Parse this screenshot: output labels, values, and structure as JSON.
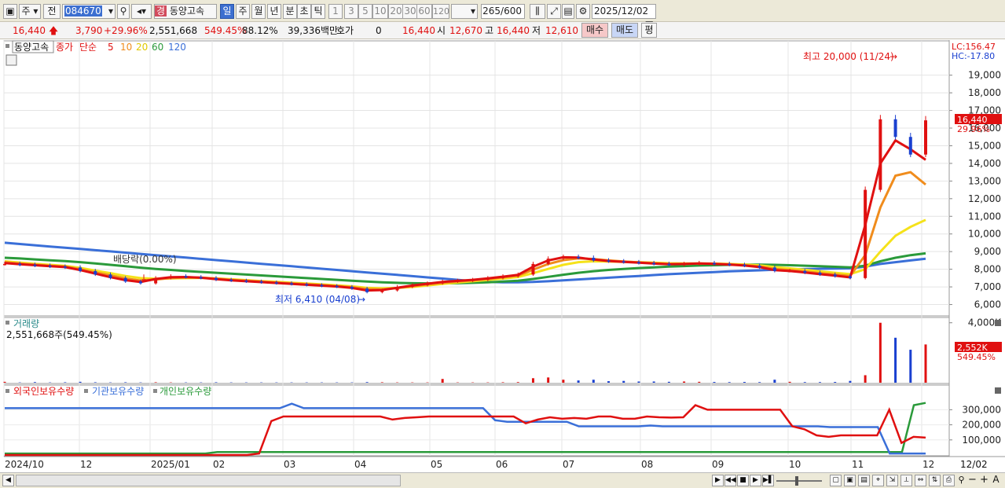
{
  "toolbar": {
    "period": "주",
    "prev": "전",
    "code": "084670",
    "stock_name": "동양고속",
    "name_badge": "경",
    "tabs": [
      "일",
      "주",
      "월",
      "년",
      "분",
      "초",
      "틱"
    ],
    "active_tab": "일",
    "intervals": [
      "1",
      "3",
      "5",
      "10",
      "20",
      "30",
      "60",
      "120"
    ],
    "count": "265",
    "count_total": "/600",
    "date": "2025/12/02"
  },
  "quote": {
    "price": "16,440",
    "change": "3,790",
    "change_pct": "+29.96%",
    "volume": "2,551,668",
    "volume_pct": "549.45%",
    "ratio": "88.12%",
    "amount": "39,336백만",
    "hoga_label": "호가",
    "hoga": "0",
    "ask": "16,440",
    "open_label": "시",
    "open": "12,670",
    "high_label": "고",
    "high": "16,440",
    "low_label": "저",
    "low": "12,610",
    "buy": "매수",
    "sell": "매도",
    "eval": "평"
  },
  "legend": {
    "name": "동양고속",
    "close_label": "종가",
    "simple": "단순",
    "ma": [
      "5",
      "10",
      "20",
      "60",
      "120"
    ]
  },
  "colors": {
    "up": "#e01010",
    "down": "#1a40d0",
    "ma5": "#e01010",
    "ma10": "#f08c1c",
    "ma20": "#f5e21a",
    "ma60": "#2a9a3a",
    "ma120": "#3a6fd8",
    "foreign": "#e01010",
    "institution": "#3a6fd8",
    "individual": "#2a9a3a"
  },
  "chart_data": [
    {
      "type": "candlestick",
      "title": "동양고속",
      "y_ticks": [
        "6,000",
        "7,000",
        "8,000",
        "9,000",
        "10,000",
        "11,000",
        "12,000",
        "13,000",
        "14,000",
        "15,000",
        "16,000",
        "17,000",
        "18,000",
        "19,000"
      ],
      "ylim": [
        5400,
        20900
      ],
      "x_ticks": [
        "2024/10",
        "12",
        "2025/01",
        "02",
        "03",
        "04",
        "05",
        "06",
        "07",
        "08",
        "09",
        "10",
        "11",
        "12"
      ],
      "last_price": "16,440",
      "last_pct": "29.96%",
      "lc": "LC:156.47",
      "hc": "HC:-17.80",
      "annotations": {
        "high": "최고 20,000 (11/24)",
        "low": "최저 6,410 (04/08)",
        "dividend": "배당락(0.00%)"
      },
      "series": [
        {
          "name": "종가",
          "values": [
            8300,
            8250,
            8200,
            8150,
            8100,
            7900,
            7700,
            7500,
            7300,
            7200,
            7500,
            7600,
            7550,
            7500,
            7400,
            7350,
            7300,
            7250,
            7200,
            7150,
            7100,
            7050,
            7000,
            6900,
            6700,
            6800,
            7000,
            7100,
            7200,
            7300,
            7350,
            7400,
            7500,
            7600,
            7700,
            8300,
            8600,
            8700,
            8650,
            8500,
            8450,
            8400,
            8350,
            8300,
            8250,
            8300,
            8350,
            8300,
            8250,
            8200,
            8100,
            7900,
            7900,
            7800,
            7700,
            7600,
            7500,
            12500,
            16500,
            15500,
            14500,
            16440
          ]
        },
        {
          "name": "5",
          "values": [
            8350,
            8280,
            8230,
            8170,
            8120,
            7950,
            7750,
            7550,
            7380,
            7280,
            7450,
            7550,
            7560,
            7520,
            7440,
            7370,
            7320,
            7270,
            7220,
            7170,
            7120,
            7070,
            7020,
            6940,
            6800,
            6820,
            6950,
            7080,
            7180,
            7280,
            7340,
            7400,
            7480,
            7580,
            7680,
            8150,
            8500,
            8680,
            8660,
            8550,
            8470,
            8420,
            8370,
            8320,
            8280,
            8300,
            8330,
            8310,
            8260,
            8210,
            8120,
            7950,
            7900,
            7820,
            7720,
            7640,
            7540,
            10500,
            14000,
            15300,
            14800,
            14200
          ]
        },
        {
          "name": "10",
          "values": [
            8400,
            8320,
            8260,
            8200,
            8150,
            8000,
            7820,
            7650,
            7480,
            7360,
            7420,
            7500,
            7540,
            7530,
            7470,
            7400,
            7350,
            7300,
            7250,
            7200,
            7150,
            7100,
            7050,
            6980,
            6880,
            6860,
            6930,
            7040,
            7140,
            7230,
            7310,
            7370,
            7450,
            7540,
            7640,
            7980,
            8300,
            8520,
            8620,
            8580,
            8500,
            8440,
            8390,
            8340,
            8300,
            8300,
            8320,
            8310,
            8280,
            8230,
            8160,
            8020,
            7950,
            7870,
            7780,
            7700,
            7620,
            8800,
            11500,
            13300,
            13500,
            12800
          ]
        },
        {
          "name": "20",
          "values": [
            8450,
            8380,
            8310,
            8250,
            8190,
            8080,
            7920,
            7780,
            7620,
            7500,
            7460,
            7480,
            7500,
            7510,
            7480,
            7430,
            7380,
            7330,
            7290,
            7240,
            7190,
            7140,
            7090,
            7030,
            6950,
            6920,
            6940,
            7000,
            7080,
            7170,
            7250,
            7320,
            7390,
            7470,
            7560,
            7780,
            8020,
            8250,
            8400,
            8450,
            8440,
            8420,
            8400,
            8370,
            8340,
            8330,
            8330,
            8320,
            8300,
            8270,
            8220,
            8120,
            8050,
            7970,
            7880,
            7800,
            7720,
            8000,
            9000,
            9900,
            10400,
            10800
          ]
        },
        {
          "name": "60",
          "values": [
            8650,
            8610,
            8560,
            8510,
            8460,
            8400,
            8330,
            8250,
            8170,
            8090,
            8020,
            7960,
            7900,
            7850,
            7800,
            7750,
            7700,
            7650,
            7600,
            7550,
            7500,
            7450,
            7400,
            7350,
            7300,
            7260,
            7230,
            7210,
            7200,
            7200,
            7210,
            7230,
            7260,
            7300,
            7350,
            7450,
            7570,
            7690,
            7800,
            7890,
            7960,
            8020,
            8070,
            8110,
            8150,
            8180,
            8210,
            8230,
            8250,
            8260,
            8260,
            8250,
            8230,
            8200,
            8170,
            8140,
            8110,
            8200,
            8450,
            8650,
            8800,
            8900
          ]
        },
        {
          "name": "120",
          "values": [
            9500,
            9430,
            9360,
            9290,
            9220,
            9150,
            9080,
            9010,
            8940,
            8870,
            8800,
            8730,
            8660,
            8590,
            8520,
            8450,
            8380,
            8310,
            8240,
            8170,
            8100,
            8030,
            7960,
            7890,
            7820,
            7750,
            7680,
            7610,
            7540,
            7470,
            7400,
            7330,
            7280,
            7260,
            7260,
            7280,
            7320,
            7370,
            7420,
            7470,
            7520,
            7570,
            7620,
            7670,
            7720,
            7760,
            7800,
            7840,
            7880,
            7910,
            7940,
            7970,
            7990,
            8010,
            8030,
            8040,
            8050,
            8150,
            8300,
            8400,
            8500,
            8600
          ]
        }
      ]
    },
    {
      "type": "bar",
      "title": "거래량",
      "value_label": "2,551,668주(549.45%)",
      "y_ticks": [
        "4,000K"
      ],
      "ylim": [
        0,
        4300
      ],
      "last_value": "2,552K",
      "last_pct": "549.45%",
      "series": [
        {
          "name": "거래량",
          "values": [
            60,
            20,
            40,
            20,
            30,
            60,
            30,
            20,
            30,
            20,
            30,
            20,
            20,
            20,
            30,
            20,
            20,
            20,
            20,
            20,
            20,
            20,
            20,
            20,
            40,
            30,
            20,
            20,
            20,
            250,
            20,
            20,
            20,
            30,
            40,
            300,
            350,
            200,
            150,
            200,
            100,
            120,
            80,
            80,
            60,
            80,
            60,
            50,
            40,
            50,
            40,
            200,
            60,
            40,
            40,
            50,
            120,
            500,
            4000,
            3000,
            2200,
            2552
          ]
        }
      ]
    },
    {
      "type": "line",
      "title": "외국인보유수량",
      "y_ticks": [
        "100,000",
        "200,000",
        "300,000"
      ],
      "ylim": [
        0,
        380000
      ],
      "series": [
        {
          "name": "외국인보유수량",
          "values": [
            0,
            0,
            0,
            0,
            0,
            0,
            0,
            0,
            0,
            0,
            0,
            0,
            0,
            0,
            0,
            0,
            0,
            0,
            0,
            0,
            0,
            10000,
            225000,
            255000,
            255000,
            255000,
            255000,
            255000,
            255000,
            255000,
            255000,
            255000,
            235000,
            245000,
            250000,
            255000,
            255000,
            255000,
            255000,
            255000,
            255000,
            255000,
            255000,
            210000,
            235000,
            250000,
            240000,
            245000,
            240000,
            255000,
            255000,
            240000,
            240000,
            255000,
            250000,
            248000,
            250000,
            330000,
            300000,
            300000,
            300000,
            300000,
            300000,
            300000,
            300000,
            190000,
            170000,
            130000,
            120000,
            130000,
            130000,
            130000,
            130000,
            300000,
            80000,
            120000,
            115000
          ]
        },
        {
          "name": "기관보유수량",
          "values": [
            310000,
            310000,
            310000,
            310000,
            310000,
            310000,
            310000,
            310000,
            310000,
            310000,
            310000,
            310000,
            310000,
            310000,
            310000,
            310000,
            310000,
            310000,
            310000,
            310000,
            310000,
            310000,
            310000,
            310000,
            340000,
            310000,
            310000,
            310000,
            310000,
            310000,
            310000,
            310000,
            310000,
            310000,
            310000,
            310000,
            310000,
            310000,
            310000,
            310000,
            310000,
            230000,
            220000,
            220000,
            220000,
            220000,
            220000,
            220000,
            190000,
            190000,
            190000,
            190000,
            190000,
            190000,
            195000,
            190000,
            190000,
            190000,
            190000,
            190000,
            190000,
            190000,
            190000,
            190000,
            190000,
            190000,
            190000,
            190000,
            190000,
            185000,
            185000,
            185000,
            185000,
            185000,
            10000,
            10000,
            10000,
            10000
          ]
        },
        {
          "name": "개인보유수량",
          "values": [
            10000,
            10000,
            10000,
            10000,
            10000,
            10000,
            10000,
            10000,
            10000,
            10000,
            10000,
            10000,
            10000,
            10000,
            10000,
            10000,
            10000,
            10000,
            20000,
            20000,
            20000,
            20000,
            20000,
            20000,
            20000,
            20000,
            20000,
            20000,
            20000,
            20000,
            20000,
            20000,
            20000,
            20000,
            20000,
            20000,
            20000,
            20000,
            20000,
            20000,
            20000,
            20000,
            20000,
            20000,
            20000,
            20000,
            20000,
            20000,
            20000,
            20000,
            20000,
            20000,
            20000,
            20000,
            20000,
            20000,
            20000,
            20000,
            20000,
            20000,
            20000,
            20000,
            20000,
            20000,
            20000,
            20000,
            20000,
            20000,
            20000,
            20000,
            20000,
            20000,
            20000,
            20000,
            20000,
            20000,
            20000,
            330000,
            345000
          ]
        }
      ]
    }
  ],
  "x_axis": [
    "2024/10",
    "12",
    "2025/01",
    "02",
    "03",
    "04",
    "05",
    "06",
    "07",
    "08",
    "09",
    "10",
    "11",
    "12"
  ],
  "x_axis_right": "12/02"
}
